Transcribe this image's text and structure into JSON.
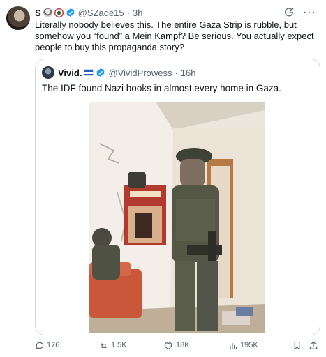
{
  "tweet": {
    "display_name": "S",
    "handle": "@SZade15",
    "separator": "·",
    "time": "3h",
    "text": "Literally nobody believes this. The entire Gaza Strip is rubble, but somehow you “found” a Mein Kampf? Be serious. You actually expect people to buy this propaganda story?",
    "more_label": "···"
  },
  "quote": {
    "display_name": "Vivid.",
    "handle": "@VividProwess",
    "separator": "·",
    "time": "16h",
    "text": "The IDF found Nazi books in almost every home in Gaza."
  },
  "actions": {
    "replies": "176",
    "reposts": "1.5K",
    "likes": "18K",
    "views": "195K"
  },
  "icons": [
    "avatar",
    "verified-icon",
    "grok-icon",
    "more-icon",
    "flag-icon",
    "reply-icon",
    "repost-icon",
    "like-icon",
    "views-icon",
    "bookmark-icon",
    "share-icon"
  ],
  "colors": {
    "text": "#0f1419",
    "secondary": "#536471",
    "verified": "#1d9bf0",
    "border": "#cfd9de"
  }
}
